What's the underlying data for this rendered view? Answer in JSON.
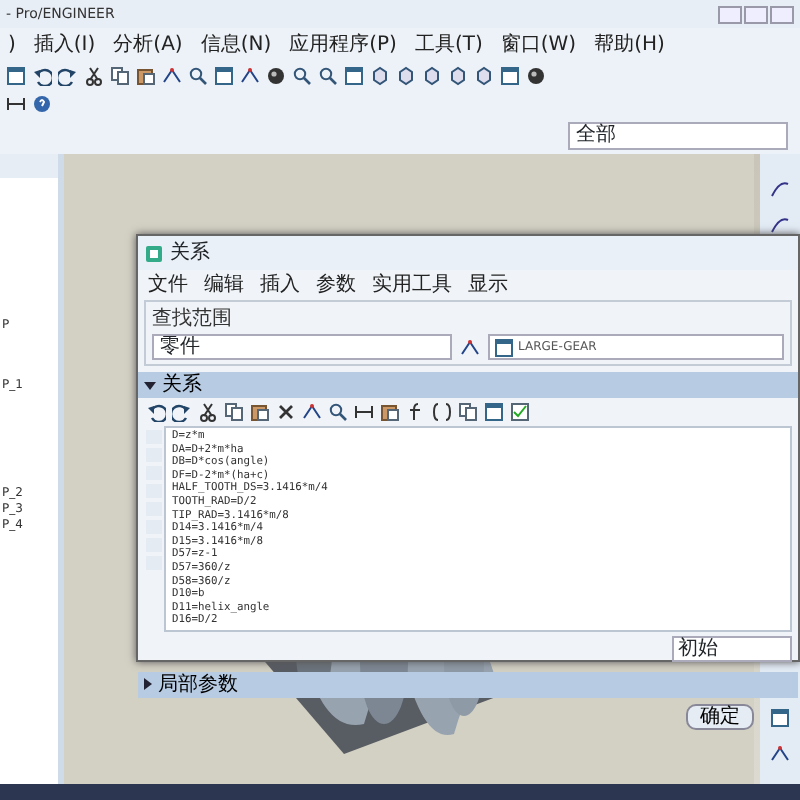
{
  "window": {
    "title": "- Pro/ENGINEER"
  },
  "menu": [
    ")",
    "插入(I)",
    "分析(A)",
    "信息(N)",
    "应用程序(P)",
    "工具(T)",
    "窗口(W)",
    "帮助(H)"
  ],
  "filter": {
    "value": "全部"
  },
  "model_tree": {
    "items": [
      "P",
      "P_1",
      "P_2",
      "P_3",
      "P_4"
    ]
  },
  "dialog": {
    "title": "关系",
    "menu": [
      "文件",
      "编辑",
      "插入",
      "参数",
      "实用工具",
      "显示"
    ],
    "look_in": {
      "label": "查找范围",
      "value": "零件",
      "object": "LARGE-GEAR"
    },
    "relations_section": {
      "label": "关系",
      "expanded": true
    },
    "relations": [
      "D=z*m",
      "DA=D+2*m*ha",
      "DB=D*cos(angle)",
      "DF=D-2*m*(ha+c)",
      "HALF_TOOTH_DS=3.1416*m/4",
      "TOOTH_RAD=D/2",
      "TIP_RAD=3.1416*m/8",
      "D14=3.1416*m/4",
      "D15=3.1416*m/8",
      "D57=z-1",
      "D57=360/z",
      "D58=360/z",
      "D10=b",
      "D11=helix_angle",
      "D16=D/2"
    ],
    "sort": "初始",
    "local_params": {
      "label": "局部参数",
      "expanded": false
    },
    "ok": "确定"
  }
}
